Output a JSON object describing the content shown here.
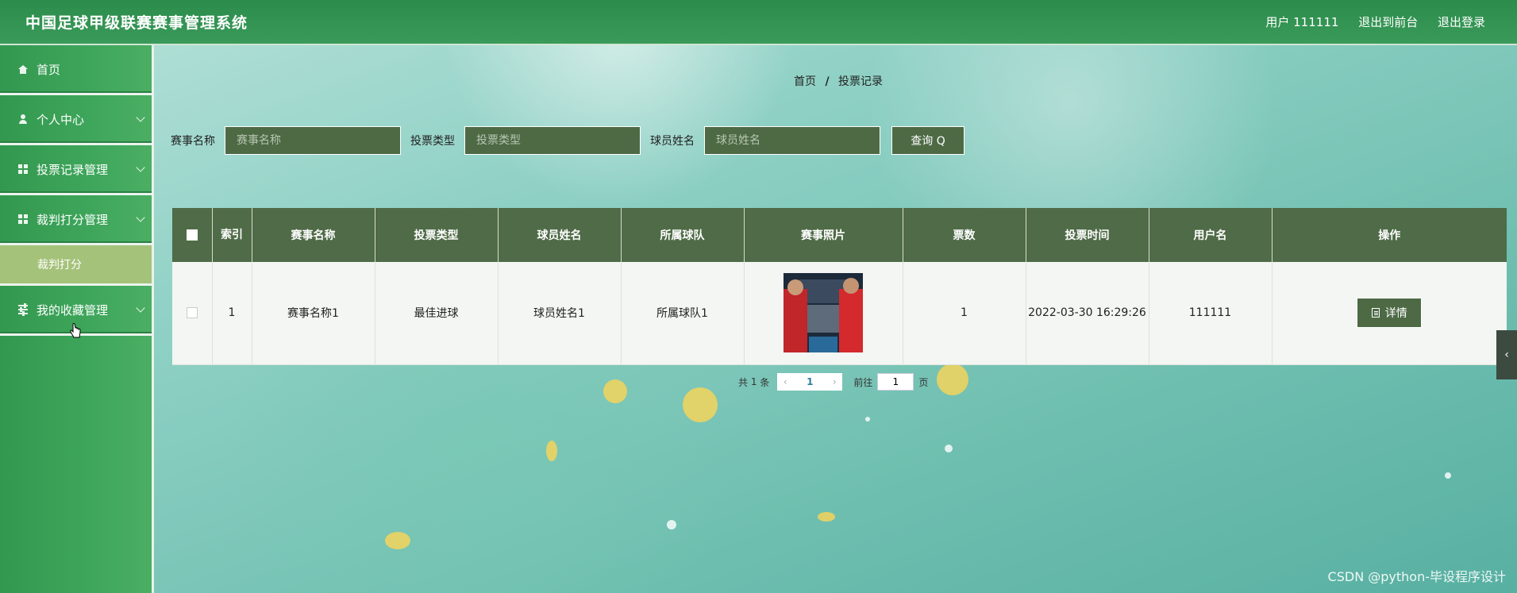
{
  "app": {
    "title": "中国足球甲级联赛赛事管理系统"
  },
  "header": {
    "user_label": "用户 111111",
    "front_link": "退出到前台",
    "logout_link": "退出登录"
  },
  "sidebar": {
    "items": [
      {
        "label": "首页",
        "icon": "home-icon"
      },
      {
        "label": "个人中心",
        "icon": "person-icon"
      },
      {
        "label": "投票记录管理",
        "icon": "grid-icon"
      },
      {
        "label": "裁判打分管理",
        "icon": "grid-icon"
      },
      {
        "label": "我的收藏管理",
        "icon": "sliders-icon"
      }
    ],
    "submenu": {
      "label": "裁判打分"
    }
  },
  "breadcrumb": {
    "home": "首页",
    "sep": "/",
    "current": "投票记录"
  },
  "search": {
    "match_label": "赛事名称",
    "match_placeholder": "赛事名称",
    "vote_type_label": "投票类型",
    "vote_type_placeholder": "投票类型",
    "player_label": "球员姓名",
    "player_placeholder": "球员姓名",
    "query_button": "查询 Q"
  },
  "table": {
    "headers": [
      "索引",
      "赛事名称",
      "投票类型",
      "球员姓名",
      "所属球队",
      "赛事照片",
      "票数",
      "投票时间",
      "用户名",
      "操作"
    ],
    "rows": [
      {
        "index": "1",
        "match_name": "赛事名称1",
        "vote_type": "最佳进球",
        "player_name": "球员姓名1",
        "team": "所属球队1",
        "votes": "1",
        "vote_time": "2022-03-30 16:29:26",
        "username": "111111",
        "action": "详情"
      }
    ]
  },
  "pagination": {
    "total_prefix": "共",
    "total": "1",
    "total_suffix": "条",
    "current_page": "1",
    "goto_prefix": "前往",
    "goto_value": "1",
    "goto_suffix": "页"
  },
  "watermark": "CSDN @python-毕设程序设计",
  "colors": {
    "header_green": "#2b8c4b",
    "table_header": "#4f6b47",
    "submenu_active": "#a5c27a",
    "button_bg": "#4d6a45"
  }
}
